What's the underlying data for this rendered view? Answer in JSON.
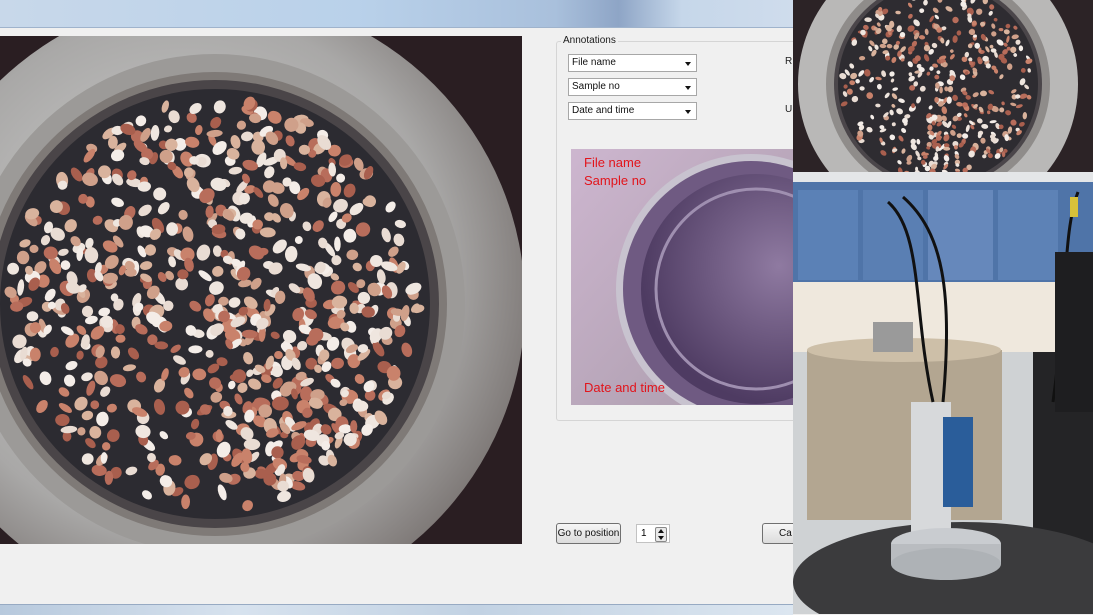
{
  "annotations": {
    "group_label": "Annotations",
    "selects": [
      {
        "value": "File name"
      },
      {
        "value": "Sample no"
      },
      {
        "value": "Date and time"
      }
    ],
    "cut_labels": [
      "R",
      "U"
    ]
  },
  "preview": {
    "overlay_top_line1": "File name",
    "overlay_top_line2": "Sample no",
    "overlay_bottom": "Date and time",
    "overlay_color": "#e2141b"
  },
  "controls": {
    "goto_button": "Go to position",
    "position_value": "1",
    "cut_button": "Ca"
  },
  "icons": [
    "chevron-down-icon",
    "spin-up-icon",
    "spin-down-icon"
  ],
  "images": [
    "sample-sieve-image",
    "sieve-photo",
    "camera-rig-photo"
  ]
}
